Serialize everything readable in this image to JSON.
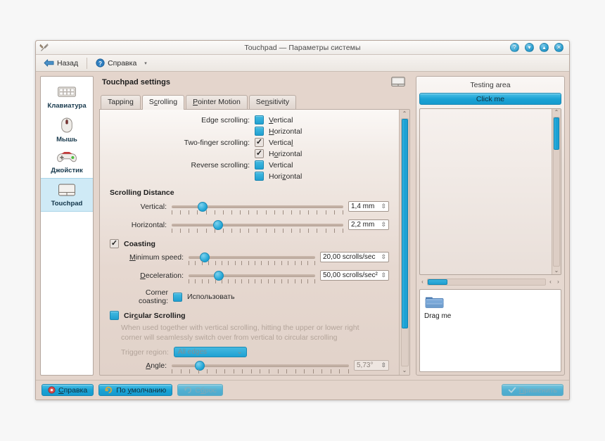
{
  "window": {
    "title": "Touchpad — Параметры системы",
    "app_icon": "tools-icon",
    "controls": [
      {
        "name": "help-window-button",
        "glyph": "?"
      },
      {
        "name": "minimize-button",
        "glyph": "▾"
      },
      {
        "name": "maximize-button",
        "glyph": "▴"
      },
      {
        "name": "close-button",
        "glyph": "✕"
      }
    ]
  },
  "toolbar": {
    "back_label": "Назад",
    "help_label": "Справка",
    "dropdown_glyph": "▾"
  },
  "sidebar": {
    "items": [
      {
        "label": "Клавиатура",
        "icon": "keyboard-icon",
        "selected": false
      },
      {
        "label": "Мышь",
        "icon": "mouse-icon",
        "selected": false
      },
      {
        "label": "Джойстик",
        "icon": "joystick-icon",
        "selected": false
      },
      {
        "label": "Touchpad",
        "icon": "touchpad-icon",
        "selected": true
      }
    ]
  },
  "main": {
    "page_title": "Touchpad settings",
    "header_icon": "touchpad-icon",
    "tabs": [
      {
        "label": "Tapping",
        "active": false
      },
      {
        "label": "Scrolling",
        "active": true
      },
      {
        "label": "Pointer Motion",
        "active": false
      },
      {
        "label": "Sensitivity",
        "active": false
      }
    ],
    "scrolling": {
      "edge_label": "Edge scrolling:",
      "edge_vertical": {
        "label": "Vertical",
        "checked": false
      },
      "edge_horizontal": {
        "label": "Horizontal",
        "checked": false
      },
      "twofinger_label": "Two-finger scrolling:",
      "twofinger_vertical": {
        "label": "Vertical",
        "checked": true
      },
      "twofinger_horizontal": {
        "label": "Horizontal",
        "checked": true
      },
      "reverse_label": "Reverse scrolling:",
      "reverse_vertical": {
        "label": "Vertical",
        "checked": false
      },
      "reverse_horizontal": {
        "label": "Horizontal",
        "checked": false
      },
      "distance_group": "Scrolling Distance",
      "vertical_slider": {
        "label": "Vertical:",
        "value": "1,4 mm",
        "pos_pct": 15
      },
      "horizontal_slider": {
        "label": "Horizontal:",
        "value": "2,2 mm",
        "pos_pct": 24
      },
      "coasting": {
        "label": "Coasting",
        "checked": true
      },
      "min_speed": {
        "label": "Minimum speed:",
        "value": "20,00 scrolls/sec",
        "pos_pct": 9
      },
      "deceleration": {
        "label": "Deceleration:",
        "value": "50,00 scrolls/sec²",
        "pos_pct": 20
      },
      "corner_coasting": {
        "label": "Corner coasting:",
        "value_label": "Использовать",
        "checked": false
      },
      "circular": {
        "label": "Circular Scrolling",
        "checked": false
      },
      "circular_desc": "When used together with vertical scrolling, hitting the upper or lower right corner will seamlessly switch over from vertical to circular scrolling",
      "trigger_region": {
        "label": "Trigger region:",
        "value": "All edges",
        "chevron": "⌄"
      },
      "angle": {
        "label": "Angle:",
        "value": "5,73°",
        "pos_pct": 13
      }
    }
  },
  "testing": {
    "title": "Testing area",
    "click_button": "Click me",
    "drag_label": "Drag me",
    "drag_icon": "folder-icon",
    "scroll_left_arrow": "‹",
    "scroll_right_arrow": "›",
    "scroll_up_arrow": "ⱏ",
    "scroll_down_arrow": "ⱟ"
  },
  "footer": {
    "help": {
      "label": "Справка",
      "icon": "help-icon",
      "disabled": false
    },
    "defaults": {
      "label": "По умолчанию",
      "icon": "defaults-icon",
      "disabled": false
    },
    "reset": {
      "label": "Сброс",
      "icon": "undo-icon",
      "disabled": true
    },
    "apply": {
      "label": "Применить",
      "icon": "check-icon",
      "disabled": true
    }
  },
  "colors": {
    "accent": "#1fa1d2",
    "window_bg": "#e4d5cc",
    "selected_sidebar": "#cfeaf6"
  }
}
